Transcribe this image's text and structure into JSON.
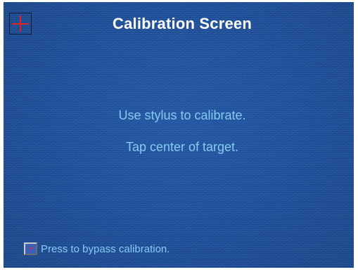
{
  "screen": {
    "title": "Calibration Screen",
    "instructions": [
      "Use stylus to calibrate.",
      "Tap center of target."
    ],
    "bypass": {
      "label": "Press to bypass calibration.",
      "icon": "fast-forward-icon",
      "glyph": "»"
    },
    "target": {
      "icon": "crosshair-target-icon"
    }
  },
  "colors": {
    "background": "#1b4f9e",
    "title": "#ffffff",
    "instruction_text": "#86cbf3",
    "crosshair": "#e02020"
  }
}
